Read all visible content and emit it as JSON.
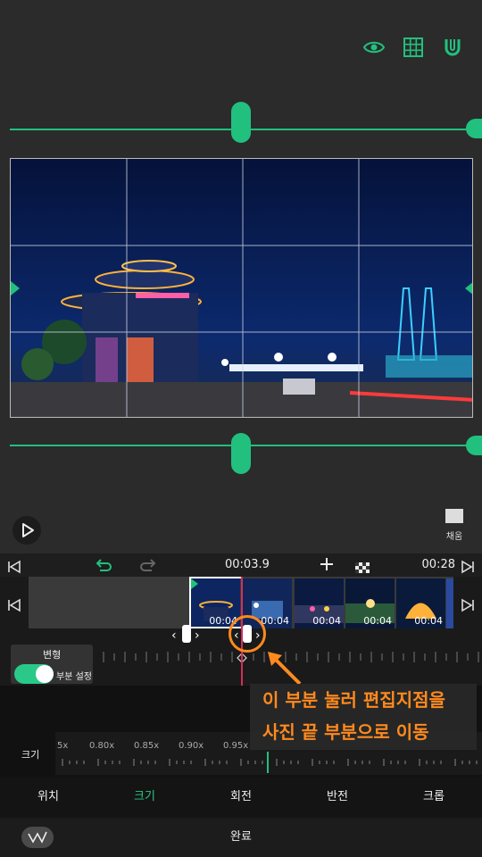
{
  "preview": {
    "icons": [
      "eye-icon",
      "grid-icon",
      "magnet-icon"
    ],
    "fill_label": "채움",
    "accent": "#21c07e"
  },
  "timeline": {
    "current_time": "00:03.9",
    "end_time": "00:28",
    "clips": [
      {
        "duration": "00:04",
        "selected": true
      },
      {
        "duration": "00:04"
      },
      {
        "duration": "00:04"
      },
      {
        "duration": "00:04"
      },
      {
        "duration": "00:04"
      }
    ]
  },
  "transform": {
    "title": "변형",
    "toggle_label": "부분 설정",
    "toggle_on": true
  },
  "size": {
    "label": "크기",
    "scale_labels": [
      "5x",
      "0.80x",
      "0.85x",
      "0.90x",
      "0.95x"
    ]
  },
  "tabs": [
    {
      "label": "위치",
      "active": false
    },
    {
      "label": "크기",
      "active": true
    },
    {
      "label": "회전",
      "active": false
    },
    {
      "label": "반전",
      "active": false
    },
    {
      "label": "크롭",
      "active": false
    }
  ],
  "footer": {
    "done_label": "완료"
  },
  "annotation": {
    "line1": "이 부분 눌러 편집지점을",
    "line2": "사진 끝 부분으로 이동",
    "color": "#ff8a1f"
  }
}
